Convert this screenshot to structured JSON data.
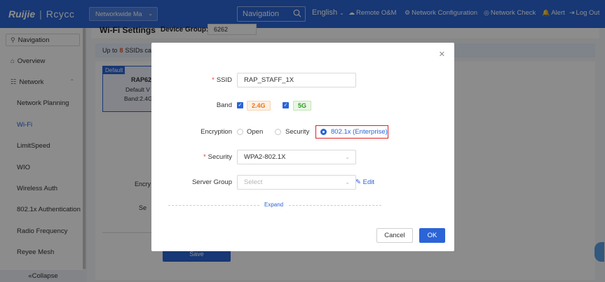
{
  "header": {
    "brand_logo": "Ruijie",
    "brand_product": "Rcycc",
    "scope": "Networkwide Ma",
    "nav_search": "Navigation",
    "language": "English",
    "remote_om": "Remote O&M",
    "network_config": "Network Configuration",
    "network_check": "Network Check",
    "alert": "Alert",
    "logout": "Log Out"
  },
  "sidebar": {
    "search_label": "Navigation",
    "items": [
      {
        "label": "Overview"
      },
      {
        "label": "Network"
      },
      {
        "label": "Network Planning"
      },
      {
        "label": "Wi-Fi"
      },
      {
        "label": "LimitSpeed"
      },
      {
        "label": "WIO"
      },
      {
        "label": "Wireless Auth"
      },
      {
        "label": "802.1x Authentication"
      },
      {
        "label": "Radio Frequency"
      },
      {
        "label": "Reyee Mesh"
      }
    ],
    "collapse": "Collapse"
  },
  "background_page": {
    "title": "Wi-Fi Settings",
    "device_group_label": "Device Group:",
    "device_group_value": "6262",
    "notice_prefix": "Up to",
    "notice_count": "8",
    "notice_suffix": "SSIDs ca",
    "default_tag": "Default",
    "device_model": "RAP62",
    "device_line1": "Default V",
    "device_line2": "Band:2.4G",
    "partial_encry": "Encry",
    "partial_se": "Se",
    "save": "Save"
  },
  "modal": {
    "ssid_label": "SSID",
    "ssid_value": "RAP_STAFF_1X",
    "band_label": "Band",
    "band_24": "2.4G",
    "band_5": "5G",
    "encryption_label": "Encryption",
    "encryption_options": [
      "Open",
      "Security",
      "802.1x (Enterprise)"
    ],
    "security_label": "Security",
    "security_value": "WPA2-802.1X",
    "server_group_label": "Server Group",
    "server_group_placeholder": "Select",
    "edit": "Edit",
    "expand": "Expand",
    "cancel": "Cancel",
    "ok": "OK"
  },
  "colors": {
    "primary": "#2b64d6",
    "band_24": "#e8761c",
    "band_5": "#2f9a28",
    "highlight": "#e02020"
  }
}
